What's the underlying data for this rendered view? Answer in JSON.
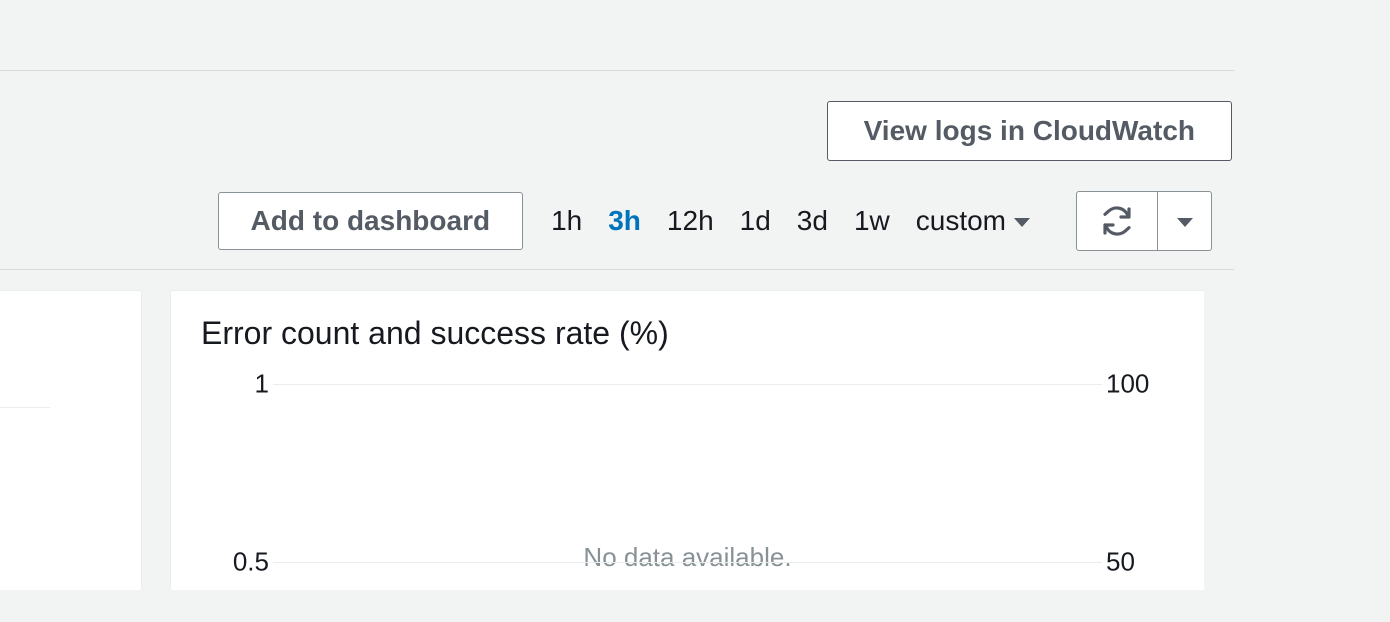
{
  "header": {
    "view_logs_label": "View logs in CloudWatch"
  },
  "toolbar": {
    "add_dashboard_label": "Add to dashboard",
    "time_ranges": [
      "1h",
      "3h",
      "12h",
      "1d",
      "3d",
      "1w"
    ],
    "active_range_index": 1,
    "custom_label": "custom"
  },
  "panel": {
    "title": "Error count and success rate (%)",
    "no_data_text": "No data available."
  },
  "chart_data": {
    "type": "line",
    "title": "Error count and success rate (%)",
    "series": [],
    "left_axis": {
      "ticks": [
        1,
        0.5
      ],
      "range": [
        0,
        1
      ]
    },
    "right_axis": {
      "ticks": [
        100,
        50
      ],
      "range": [
        0,
        100
      ]
    },
    "message": "No data available."
  }
}
